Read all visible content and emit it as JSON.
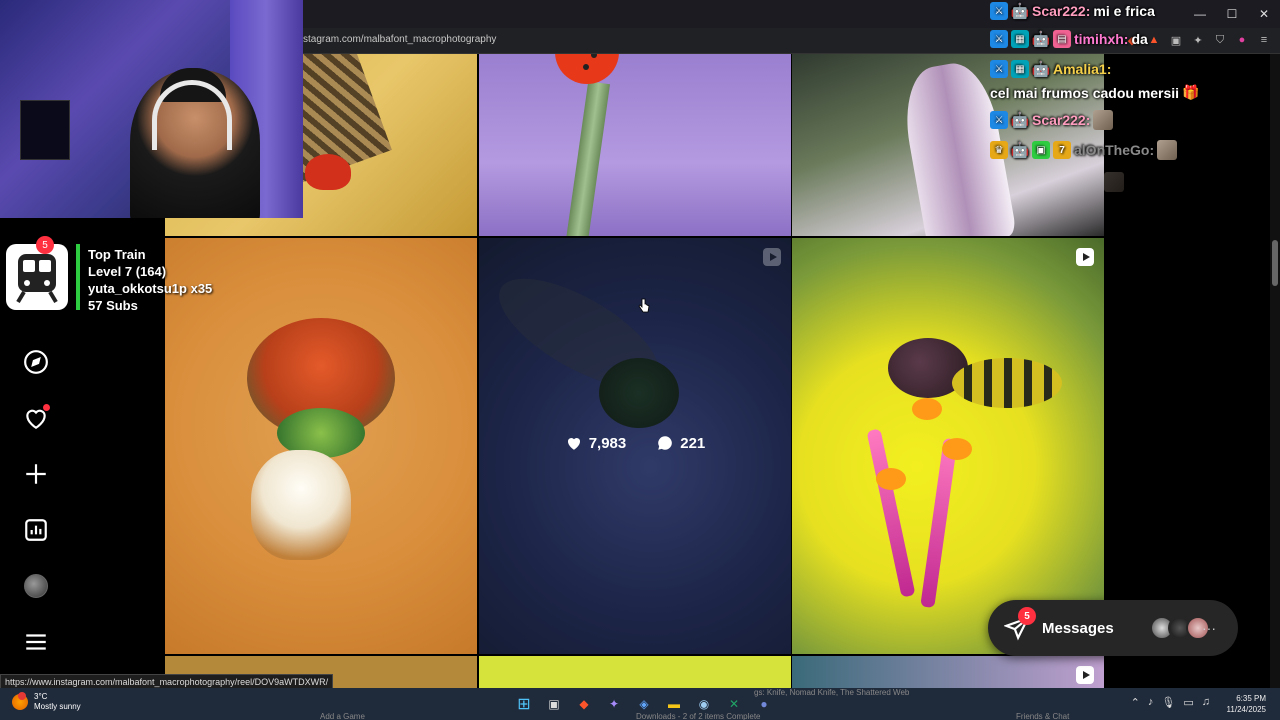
{
  "browser": {
    "url": "stagram.com/malbafont_macrophotography",
    "window_controls": [
      "—",
      "☐",
      "✕"
    ]
  },
  "colors": {
    "accent_red": "#ff3040",
    "chat_user_pink": "#ff9dbf",
    "chat_user_gold": "#f5d04a",
    "train_bar_green": "#2ecc40"
  },
  "ig_nav": {
    "icons": [
      "compass-icon",
      "heart-icon",
      "plus-icon",
      "chart-icon",
      "avatar",
      "hamburger-icon"
    ]
  },
  "post_hover": {
    "likes": "7,983",
    "comments": "221"
  },
  "top_train": {
    "count": "5",
    "title": "Top Train",
    "level": "Level 7  (164)",
    "user": "yuta_okkotsu1p x35",
    "subs": "57 Subs"
  },
  "chat": [
    {
      "user": "Scar222:",
      "message": "mi e frica"
    },
    {
      "user": "timihxh:",
      "message": "da"
    },
    {
      "user": "Amalia1:",
      "message": "cel mai frumos cadou mersii"
    },
    {
      "user": "Scar222:",
      "message": ""
    },
    {
      "user": "alOnTheGo:",
      "message": ""
    }
  ],
  "messages": {
    "count": "5",
    "label": "Messages",
    "more": "···"
  },
  "status_link": "https://www.instagram.com/malbafont_macrophotography/reel/DOV9aWTDXWR/",
  "taskbar": {
    "temperature": "3°C",
    "weather": "Mostly sunny",
    "time": "6:35 PM",
    "date": "11/24/2025"
  },
  "stream_strip": {
    "game_items": "gs: Knife, Nomad Knife, The Shattered Web",
    "add_game": "Add a Game",
    "downloads": "Downloads - 2 of 2 items Complete",
    "friends": "Friends & Chat"
  }
}
